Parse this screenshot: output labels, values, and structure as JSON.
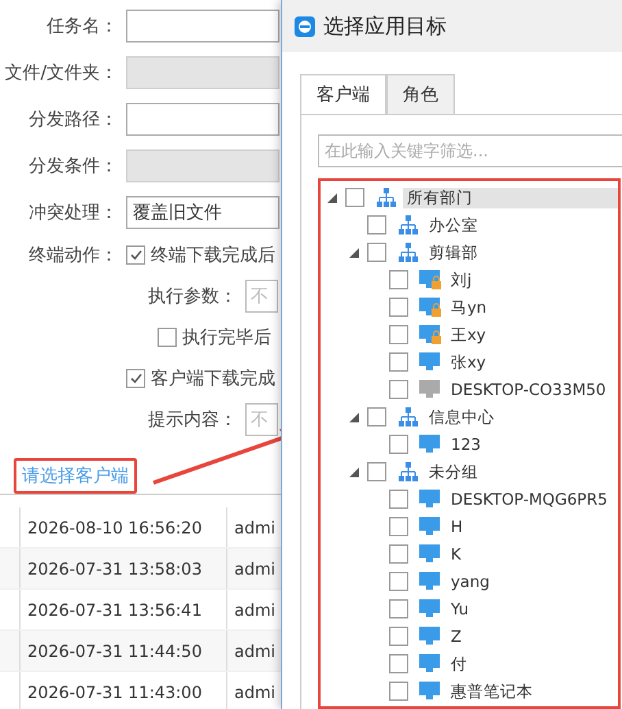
{
  "table": {
    "rows": [
      {
        "time": "2026-08-10 16:56:20",
        "user": "admi"
      },
      {
        "time": "2026-07-31 13:58:03",
        "user": "admi"
      },
      {
        "time": "2026-07-31 13:56:41",
        "user": "admi"
      },
      {
        "time": "2026-07-31 11:44:50",
        "user": "admi"
      },
      {
        "time": "2026-07-31 11:43:00",
        "user": "admi"
      }
    ]
  },
  "form": {
    "fields": [
      {
        "label": "任务名：",
        "kind": "input",
        "disabled": false
      },
      {
        "label": "文件/文件夹：",
        "kind": "input",
        "disabled": true
      },
      {
        "label": "分发路径：",
        "kind": "input",
        "disabled": false
      },
      {
        "label": "分发条件：",
        "kind": "input",
        "disabled": true
      },
      {
        "label": "冲突处理：",
        "kind": "select",
        "value": "覆盖旧文件",
        "disabled": false
      }
    ],
    "action_label": "终端动作：",
    "options": [
      {
        "kind": "checkbox",
        "label": "终端下载完成后",
        "checked": true
      },
      {
        "kind": "param",
        "label": "执行参数：",
        "placeholder": "不"
      },
      {
        "kind": "sub_checkbox",
        "label": "执行完毕后",
        "checked": false
      },
      {
        "kind": "checkbox",
        "label": "客户端下载完成",
        "checked": true
      },
      {
        "kind": "param",
        "label": "提示内容：",
        "placeholder": "不"
      }
    ],
    "link": "请选择客户端"
  },
  "dialog": {
    "title": "选择应用目标",
    "tabs": [
      {
        "label": "客户端",
        "selected": true
      },
      {
        "label": "角色",
        "selected": false
      }
    ],
    "search": {
      "placeholder": "在此输入关键字筛选..."
    },
    "tree": [
      {
        "kind": "group",
        "label": "所有部门",
        "checked": false,
        "expanded": true,
        "selected": true,
        "children": [
          {
            "kind": "group",
            "label": "办公室",
            "checked": false,
            "selected": false
          },
          {
            "kind": "group",
            "label": "剪辑部",
            "checked": false,
            "expanded": true,
            "selected": false,
            "children": [
              {
                "kind": "client",
                "label": "刘j",
                "checked": false,
                "locked": true,
                "online": true,
                "selected": false
              },
              {
                "kind": "client",
                "label": "马yn",
                "checked": false,
                "locked": true,
                "online": true,
                "selected": false
              },
              {
                "kind": "client",
                "label": "王xy",
                "checked": false,
                "locked": true,
                "online": true,
                "selected": false
              },
              {
                "kind": "client",
                "label": "张xy",
                "checked": false,
                "locked": false,
                "online": true,
                "selected": false
              },
              {
                "kind": "client",
                "label": "DESKTOP-CO33M50",
                "checked": false,
                "locked": false,
                "online": false,
                "selected": false
              }
            ]
          },
          {
            "kind": "group",
            "label": "信息中心",
            "checked": false,
            "expanded": true,
            "selected": false,
            "children": [
              {
                "kind": "client",
                "label": "123",
                "checked": false,
                "locked": false,
                "online": true,
                "selected": false
              }
            ]
          },
          {
            "kind": "group",
            "label": "未分组",
            "checked": false,
            "expanded": true,
            "selected": false,
            "children": [
              {
                "kind": "client",
                "label": "DESKTOP-MQG6PR5",
                "checked": false,
                "locked": false,
                "online": true,
                "selected": false
              },
              {
                "kind": "client",
                "label": "H",
                "checked": false,
                "locked": false,
                "online": true,
                "selected": false
              },
              {
                "kind": "client",
                "label": "K",
                "checked": false,
                "locked": false,
                "online": true,
                "selected": false
              },
              {
                "kind": "client",
                "label": "yang",
                "checked": false,
                "locked": false,
                "online": true,
                "selected": false
              },
              {
                "kind": "client",
                "label": "Yu",
                "checked": false,
                "locked": false,
                "online": true,
                "selected": false
              },
              {
                "kind": "client",
                "label": "Z",
                "checked": false,
                "locked": false,
                "online": true,
                "selected": false
              },
              {
                "kind": "client",
                "label": "付",
                "checked": false,
                "locked": false,
                "online": true,
                "selected": false
              },
              {
                "kind": "client",
                "label": "惠普笔记本",
                "checked": false,
                "locked": false,
                "online": true,
                "selected": false
              }
            ]
          }
        ]
      }
    ]
  }
}
